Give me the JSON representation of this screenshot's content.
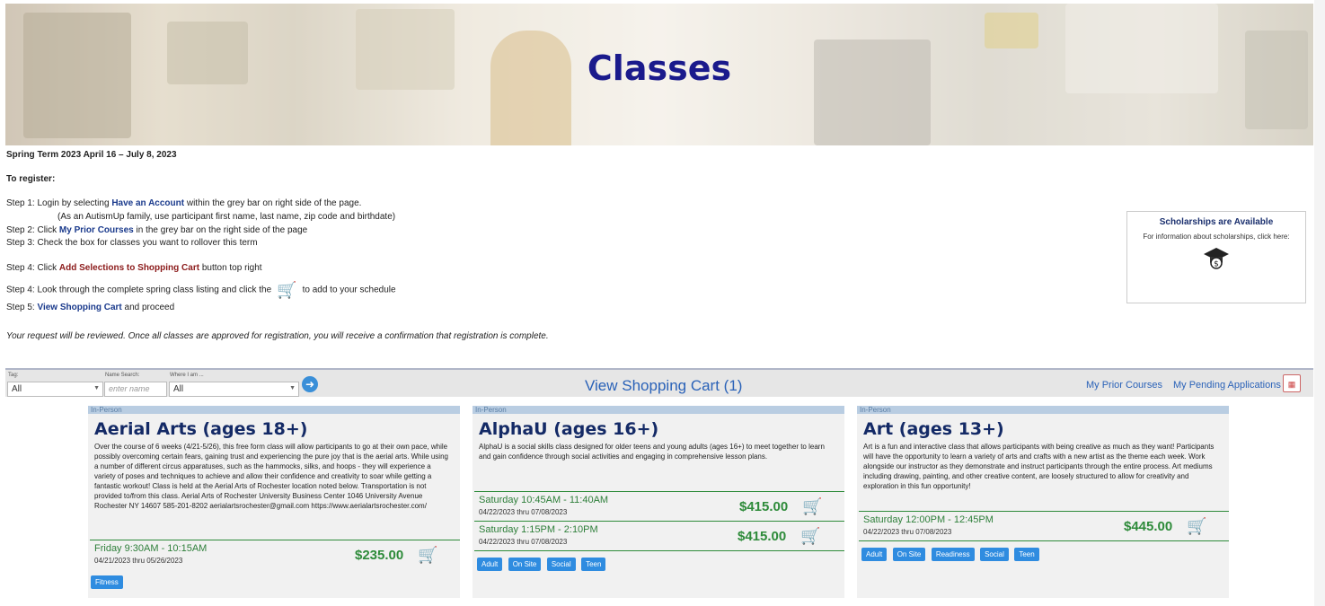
{
  "banner": {
    "title": "Classes"
  },
  "info": {
    "term": "Spring Term 2023 April 16 – July 8, 2023",
    "to_register": "To register:",
    "step1_pre": "Step 1: Login by selecting ",
    "step1_link": "Have an Account",
    "step1_post": " within the grey bar on right side of the page.",
    "step1_note": "(As an AutismUp family, use participant first name, last name, zip code and birthdate)",
    "step2_pre": "Step 2: Click ",
    "step2_link": "My Prior Courses",
    "step2_post": " in the grey bar on the right side of the page",
    "step3": "Step 3: Check the box for classes you want to rollover this term",
    "step4a_pre": "Step 4: Click ",
    "step4a_link": "Add Selections to Shopping Cart",
    "step4a_post": " button top right",
    "step4b_pre": "Step 4: Look through the complete spring class listing and click the",
    "step4b_post": "to add to your schedule",
    "step5_pre": "Step 5: ",
    "step5_link": "View Shopping Cart",
    "step5_post": " and proceed",
    "review_note": "Your request will be reviewed. Once all classes are approved for registration, you will receive a confirmation that registration is complete."
  },
  "scholarship": {
    "title": "Scholarships are Available",
    "subtitle": "For information about scholarships, click here:"
  },
  "filter": {
    "tag_label": "Tag:",
    "tag_value": "All",
    "name_label": "Name Search:",
    "name_placeholder": "enter name",
    "where_label": "Where I am ...",
    "where_value": "All",
    "cart_link": "View Shopping Cart (1)",
    "prior_link": "My Prior Courses",
    "pending_link": "My Pending Applications"
  },
  "cards": [
    {
      "type": "In-Person",
      "title": "Aerial Arts (ages 18+)",
      "desc": "Over the course of 6 weeks (4/21-5/26), this free form class will allow participants to go at their own pace, while possibly overcoming certain fears, gaining trust and experiencing the pure joy that is the aerial arts. While using a number of different circus apparatuses, such as the hammocks, silks, and hoops - they will experience a variety of poses and techniques to achieve and allow their confidence and creativity to soar while getting a fantastic workout! Class is held at the Aerial Arts of Rochester location noted below. Transportation is not provided to/from this class. Aerial Arts of Rochester University Business Center 1046 University Avenue Rochester NY 14607 585-201-8202 aerialartsrochester@gmail.com https://www.aerialartsrochester.com/",
      "sessions": [
        {
          "time": "Friday 9:30AM - 10:15AM",
          "dates": "04/21/2023 thru 05/26/2023",
          "price": "$235.00"
        }
      ],
      "tags": [
        "Fitness"
      ]
    },
    {
      "type": "In-Person",
      "title": "AlphaU (ages 16+)",
      "desc": "AlphaU is a social skills class designed for older teens and young adults (ages 16+) to meet together to learn and gain confidence through social activities and engaging in comprehensive lesson plans.",
      "sessions": [
        {
          "time": "Saturday 10:45AM - 11:40AM",
          "dates": "04/22/2023 thru 07/08/2023",
          "price": "$415.00"
        },
        {
          "time": "Saturday 1:15PM - 2:10PM",
          "dates": "04/22/2023 thru 07/08/2023",
          "price": "$415.00"
        }
      ],
      "tags": [
        "Adult",
        "On Site",
        "Social",
        "Teen"
      ]
    },
    {
      "type": "In-Person",
      "title": "Art (ages 13+)",
      "desc": "Art is a fun and interactive class that allows participants with being creative as much as they want! Participants will have the opportunity to learn a variety of arts and crafts with a new artist as the theme each week. Work alongside our instructor as they demonstrate and instruct participants through the entire process. Art mediums including drawing, painting, and other creative content, are loosely structured to allow for creativity and exploration in this fun opportunity!",
      "sessions": [
        {
          "time": "Saturday 12:00PM - 12:45PM",
          "dates": "04/22/2023 thru 07/08/2023",
          "price": "$445.00"
        }
      ],
      "tags": [
        "Adult",
        "On Site",
        "Readiness",
        "Social",
        "Teen"
      ]
    }
  ]
}
